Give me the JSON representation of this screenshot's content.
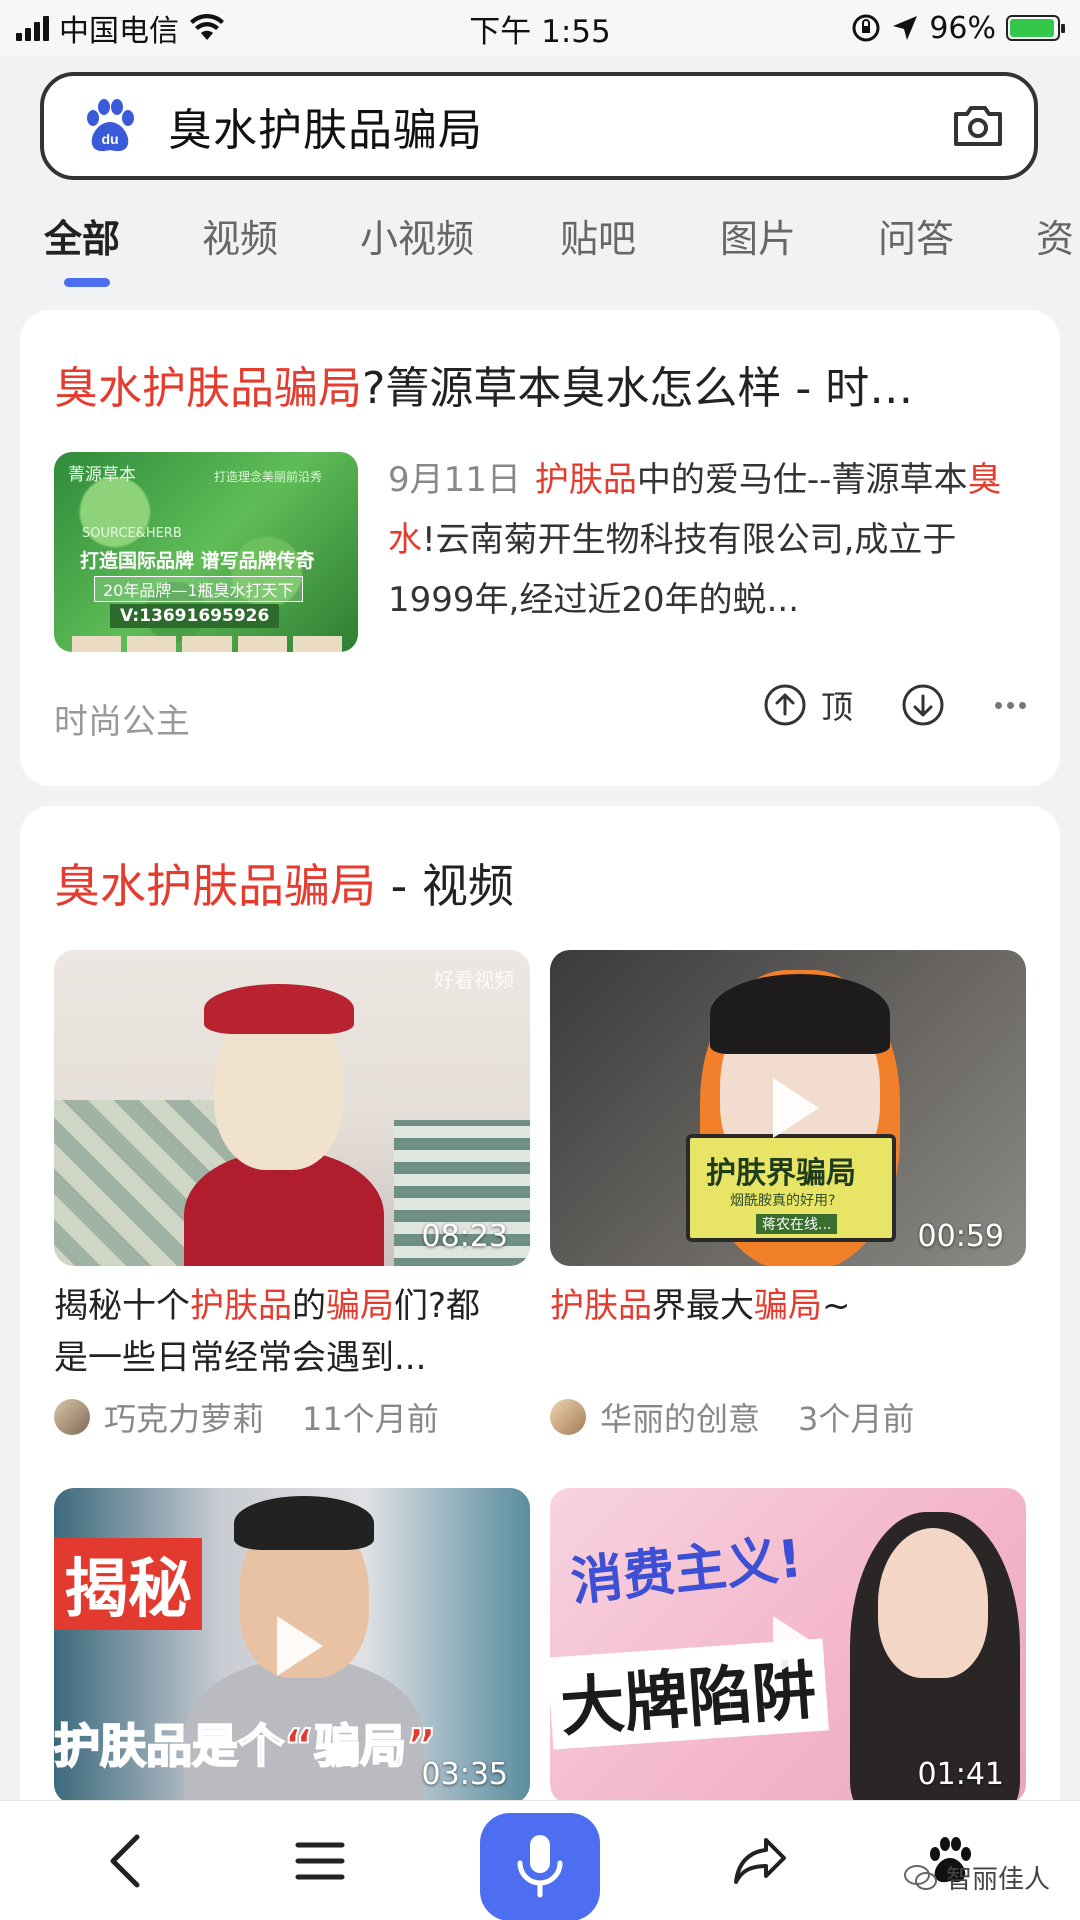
{
  "status_bar": {
    "carrier": "中国电信",
    "time": "下午 1:55",
    "battery": "96%",
    "battery_level": 0.96
  },
  "search": {
    "query": "臭水护肤品骗局",
    "logo_text": "du"
  },
  "tabs": [
    {
      "label": "全部",
      "active": true
    },
    {
      "label": "视频"
    },
    {
      "label": "小视频"
    },
    {
      "label": "贴吧"
    },
    {
      "label": "图片"
    },
    {
      "label": "问答"
    },
    {
      "label": "资"
    }
  ],
  "result1": {
    "title_highlight": "臭水护肤品骗局",
    "title_rest": "?箐源草本臭水怎么样 - 时…",
    "thumbnail": {
      "brand": "菁源草本",
      "slogan": "打造理念美丽前沿秀",
      "english": "SOURCE&HERB",
      "line1": "打造国际品牌  谱写品牌传奇",
      "line2": "20年品牌—1瓶臭水打天下",
      "phone": "V:13691695926"
    },
    "date": "9月11日",
    "snippet_hl1": "护肤品",
    "snippet_t1": "中的爱马仕--菁源草本",
    "snippet_hl2": "臭水",
    "snippet_t2": "!云南菊开生物科技有限公司,成立于1999年,经过近20年的蜕...",
    "source": "时尚公主",
    "up_label": "顶"
  },
  "video_section": {
    "title_highlight": "臭水护肤品骗局",
    "title_rest": " - 视频",
    "videos": [
      {
        "duration": "08:23",
        "watermark": "好看视频",
        "caption_t1": "揭秘十个",
        "caption_hl1": "护肤品",
        "caption_t2": "的",
        "caption_hl2": "骗局",
        "caption_t3": "们?都是一些日常经常会遇到...",
        "author": "巧克力萝莉",
        "time": "11个月前"
      },
      {
        "duration": "00:59",
        "sign_main": "护肤界骗局",
        "sign_sub": "烟酰胺真的好用?",
        "sign_tag": "蒋农在线...",
        "caption_hl1": "护肤品",
        "caption_t1": "界最大",
        "caption_hl2": "骗局",
        "caption_t2": "~",
        "author": "华丽的创意",
        "time": "3个月前"
      },
      {
        "duration": "03:35",
        "overlay_top": "揭秘",
        "overlay_bottom": "护肤品是个“骗局”"
      },
      {
        "duration": "01:41",
        "overlay_top": "消费主义!",
        "overlay_bottom": "大牌陷阱"
      }
    ]
  },
  "bottom_bar": {
    "watermark": "智丽佳人"
  },
  "colors": {
    "highlight": "#e53c2f",
    "accent": "#4e6ef2"
  }
}
